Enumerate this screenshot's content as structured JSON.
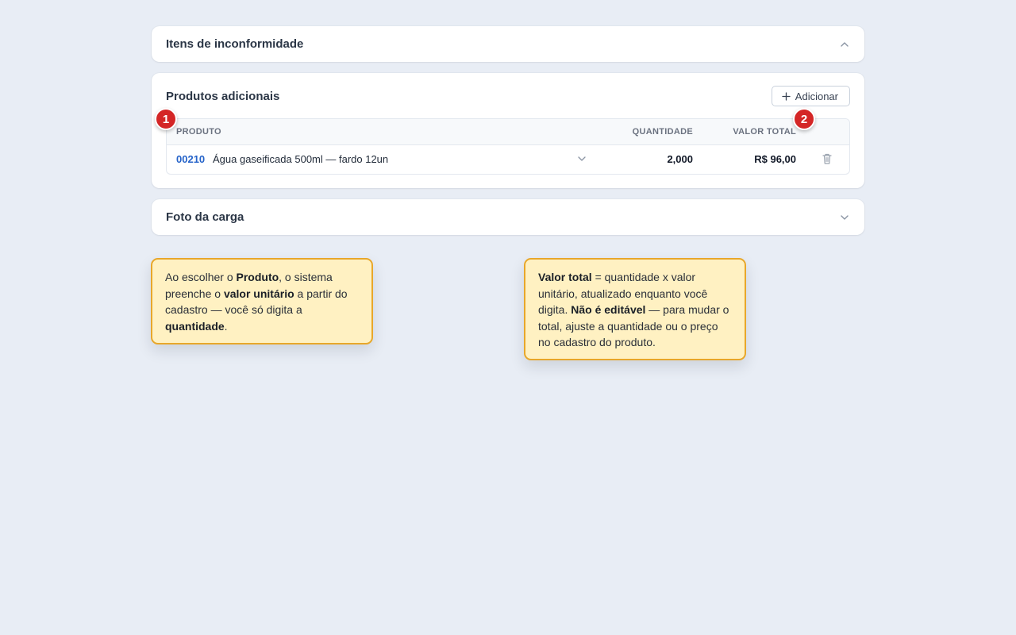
{
  "sections": {
    "itens": {
      "title": "Itens de inconformidade",
      "state": "expanded"
    },
    "produtos": {
      "title": "Produtos adicionais",
      "add_label": "Adicionar",
      "columns": {
        "produto": "PRODUTO",
        "quantidade": "QUANTIDADE",
        "valor_total": "VALOR TOTAL"
      },
      "rows": [
        {
          "code": "00210",
          "name": "Água gaseificada 500ml — fardo 12un",
          "quantidade": "2,000",
          "valor_total": "R$ 96,00"
        }
      ]
    },
    "foto": {
      "title": "Foto da carga",
      "state": "collapsed"
    }
  },
  "badges": {
    "one": "1",
    "two": "2"
  },
  "notes": {
    "one": {
      "p1": "Ao escolher o ",
      "b1": "Produto",
      "p2": ", o sistema preenche o ",
      "b2": "valor unitário",
      "p3": " a partir do cadastro — você só digita a ",
      "b3": "quantidade",
      "p4": "."
    },
    "two": {
      "b1": "Valor total",
      "p1": " = quantidade x valor unitário, atualizado enquanto você digita. ",
      "b2": "Não é editável",
      "p2": " — para mudar o total, ajuste a quantidade ou o preço no cadastro do produto."
    }
  },
  "icons": {
    "chevron_up": "chevron-up-icon",
    "chevron_down": "chevron-down-icon",
    "plus": "plus-icon",
    "trash": "trash-icon"
  },
  "colors": {
    "page_bg": "#e8edf5",
    "code_link": "#2563c9",
    "badge_red": "#d42626",
    "note_bg": "#fff1c2",
    "note_border": "#e8a72a"
  }
}
